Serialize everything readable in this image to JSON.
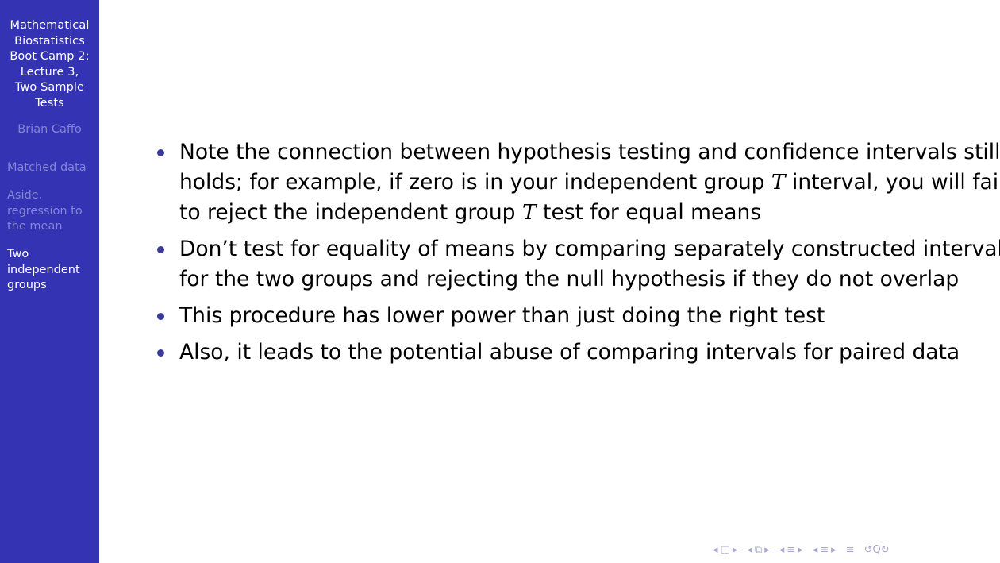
{
  "sidebar": {
    "title_lines": [
      "Mathematical",
      "Biostatistics",
      "Boot Camp 2:",
      "Lecture 3,",
      "Two Sample",
      "Tests"
    ],
    "author": "Brian Caffo",
    "sections": [
      {
        "lines": [
          "Matched data"
        ]
      },
      {
        "lines": [
          "Aside,",
          "regression to",
          "the mean"
        ]
      },
      {
        "lines": [
          "Two",
          "independent",
          "groups"
        ]
      }
    ]
  },
  "main": {
    "bullets": [
      {
        "lines": [
          {
            "before": "Note the connection between hypothesis testing and confidence intervals still"
          },
          {
            "before": "holds; for example, if zero is in your independent group ",
            "var": "T",
            "after": " interval, you will fail"
          },
          {
            "before": "to reject the independent group ",
            "var": "T",
            "after": " test for equal means"
          }
        ]
      },
      {
        "lines": [
          {
            "before": "Don’t test for equality of means by comparing separately constructed intervals"
          },
          {
            "before": "for the two groups and rejecting the null hypothesis if they do not overlap"
          }
        ]
      },
      {
        "lines": [
          {
            "before": "This procedure has lower power than just doing the right test"
          }
        ]
      },
      {
        "lines": [
          {
            "before": "Also, it leads to the potential abuse of comparing intervals for paired data"
          }
        ]
      }
    ]
  },
  "nav_icons": {
    "slide_prev": "◂",
    "slide_icon": "□",
    "slide_next": "▸",
    "frame_prev": "◂",
    "frame_icon": "⧉",
    "frame_next": "▸",
    "subsection_prev": "◂",
    "subsection_icon": "≡",
    "subsection_next": "▸",
    "section_prev": "◂",
    "section_icon": "≡",
    "section_next": "▸",
    "toc_icon": "≡",
    "search_icons": "↺Q↻"
  },
  "colors": {
    "sidebar_bg": "#3333b3",
    "sidebar_active": "#ffffff",
    "sidebar_dim": "#8585d6",
    "bullet": "#3a3a9a"
  }
}
